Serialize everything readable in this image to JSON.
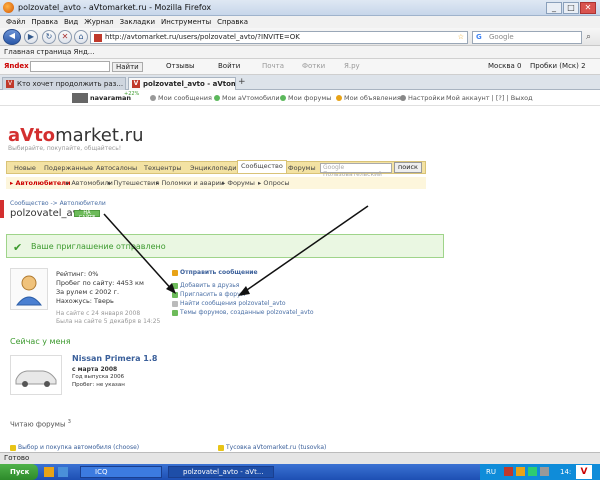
{
  "window": {
    "title": "polzovatel_avto - aVtomarket.ru - Mozilla Firefox"
  },
  "menu": [
    "Файл",
    "Правка",
    "Вид",
    "Журнал",
    "Закладки",
    "Инструменты",
    "Справка"
  ],
  "nav": {
    "url": "http://avtomarket.ru/users/polzovatel_avto/?INVITE=OK",
    "search_placeholder": "Google"
  },
  "bookmarks": {
    "item": "Главная страница Янд..."
  },
  "yabar": {
    "logo": "Яndex",
    "find_label": "Найти",
    "items": [
      "Отзывы",
      "Войти",
      "Почта",
      "Фотки",
      "Я.ру",
      "Москва 0",
      "Пробки (Мск) 2"
    ]
  },
  "tabs": [
    {
      "label": "Кто хочет продолжить раз...",
      "active": false
    },
    {
      "label": "polzovatel_avto - aVtomar...",
      "active": true
    }
  ],
  "sitebar": {
    "user": "navaraman",
    "badge": "+22%",
    "items": [
      "Мои сообщения",
      "Мои аVтомобили",
      "Мои форумы",
      "Мои объявления",
      "Настройки",
      "Мой аккаунт | [?] | Выход"
    ]
  },
  "site": {
    "logo_prefix": "aVto",
    "logo_suffix": "market.ru",
    "slogan": "Выбирайте, покупайте, общайтесь!",
    "main_tabs": [
      "Новые",
      "Подержанные",
      "Автосалоны",
      "Техцентры",
      "Энциклопедия",
      "Сообщество",
      "Форумы"
    ],
    "active_tab": "Сообщество",
    "search_placeholder": "Google Пользовательский поиск",
    "search_button": "поиск",
    "sub_tabs": [
      "Автолюбители",
      "Автомобили",
      "Путешествия",
      "Поломки и аварии",
      "Форумы",
      "Опросы"
    ],
    "breadcrumb": "Сообщество -> Автолюбители",
    "username": "polzovatel_avto",
    "user_badge": "НА САЙТЕ",
    "invite_message": "Ваше приглашение отправлено",
    "stats": {
      "rating": "Рейтинг: 0%",
      "mileage": "Пробег по сайту: 4453 км",
      "driving": "За рулем с 2002 г.",
      "location": "Нахожусь: Тверь",
      "since": "На сайте с 24 января 2008",
      "last_seen": "Была на сайте 5 декабря в 14:25"
    },
    "actions": {
      "send_message": "Отправить сообщение",
      "add_friend": "Добавить в друзья",
      "invite_forum": "Пригласить в форум",
      "find_messages": "Найти сообщения polzovatel_avto",
      "forum_topics": "Темы форумов, созданные polzovatel_avto"
    },
    "now_header": "Сейчас у меня",
    "car": {
      "name": "Nissan Primera 1.8",
      "since": "с марта 2008",
      "year": "Год выпуска 2006",
      "mileage": "Пробег: не указан"
    },
    "reading_header": "Читаю форумы",
    "reading_count": "3",
    "forums": [
      "Выбор и покупка автомобиля (choose)",
      "Тусовка aVtomarket.ru (tusovka)"
    ]
  },
  "status": {
    "text": "Готово"
  },
  "taskbar": {
    "start": "Пуск",
    "tasks": [
      "ICQ",
      "polzovatel_avto - aVt..."
    ],
    "lang": "RU",
    "clock": "14:"
  },
  "colors": {
    "accent_red": "#d32f2f",
    "green": "#3c9a2e",
    "nav_yellow": "#f3e2a3"
  }
}
